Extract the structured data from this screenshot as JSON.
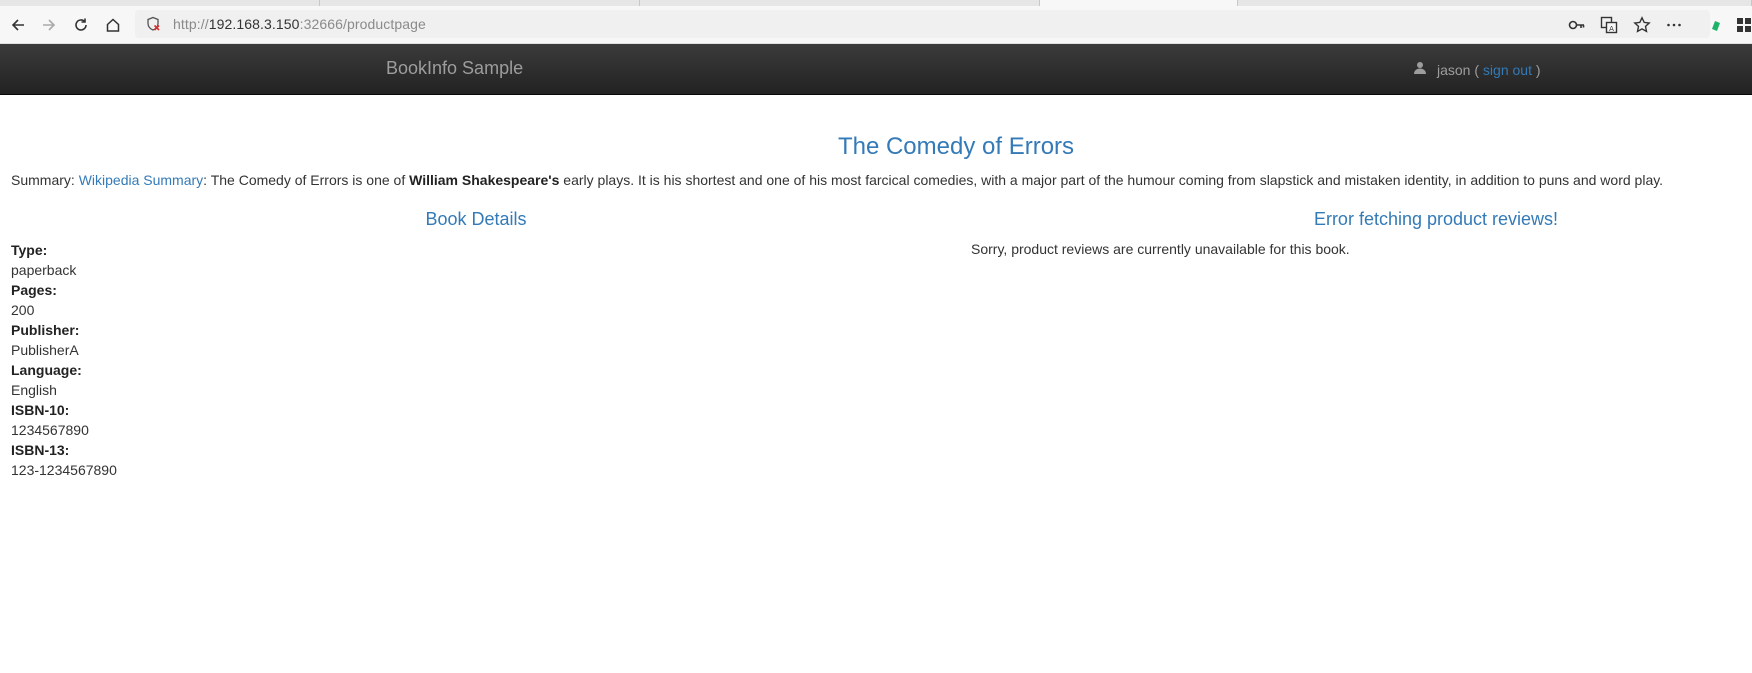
{
  "browser": {
    "url_scheme": "http://",
    "url_host": "192.168.3.150",
    "url_rest": ":32666/productpage"
  },
  "navbar": {
    "brand": "BookInfo Sample",
    "user": "jason",
    "open_paren": "(",
    "sign_out": "sign out",
    "close_paren": ")"
  },
  "book": {
    "title": "The Comedy of Errors",
    "summary_label": "Summary:",
    "summary_link": "Wikipedia Summary",
    "summary_part1": ": The Comedy of Errors is one of",
    "summary_author": "William Shakespeare's",
    "summary_part2": "early plays. It is his shortest and one of his most farcical comedies, with a major part of the humour coming from slapstick and mistaken identity, in addition to puns and word play."
  },
  "details": {
    "heading": "Book Details",
    "type_label": "Type:",
    "type_value": "paperback",
    "pages_label": "Pages:",
    "pages_value": "200",
    "publisher_label": "Publisher:",
    "publisher_value": "PublisherA",
    "language_label": "Language:",
    "language_value": "English",
    "isbn10_label": "ISBN-10:",
    "isbn10_value": "1234567890",
    "isbn13_label": "ISBN-13:",
    "isbn13_value": "123-1234567890"
  },
  "reviews": {
    "heading": "Error fetching product reviews!",
    "message": "Sorry, product reviews are currently unavailable for this book."
  },
  "colors": {
    "link": "#337ab7",
    "navbar_bg": "#222222",
    "navbar_text": "#9d9d9d"
  },
  "icons": [
    "back-arrow-icon",
    "forward-arrow-icon",
    "reload-icon",
    "home-icon",
    "insecure-shield-icon",
    "key-icon",
    "translate-icon",
    "star-icon",
    "more-icon",
    "extension-icon",
    "grid-icon",
    "user-icon"
  ]
}
